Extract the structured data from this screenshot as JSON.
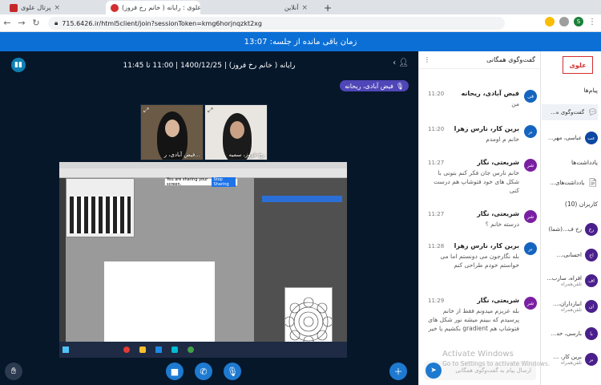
{
  "browser": {
    "tabs": [
      {
        "title": "پرتال علوی"
      },
      {
        "title": "علوی : رایانه ( خانم رخ فروز)"
      },
      {
        "title": "آنلاین"
      }
    ],
    "new_tab": "+",
    "url": "715.6426.ir/html5client/join?sessionToken=kmg6horjnqzkt2xg",
    "profile_initial": "S"
  },
  "banner": {
    "text": "زمان باقی مانده از جلسه: 13:07"
  },
  "meeting": {
    "title": "رایانه ( خانم رخ فروز) | 1400/12/25 | 11:00 تا 11:45",
    "talking_badge": "فیض آبادی، ریحانه",
    "videos": [
      {
        "label": "فیض آبادی، ر..."
      },
      {
        "label": "رخ فروز، سمیه"
      }
    ],
    "screen_share": {
      "app": "Photoshop",
      "notice": "You are sharing your screen.",
      "stop_label": "Stop Sharing"
    }
  },
  "chat": {
    "title": "گفت‌وگوی همگانی",
    "messages": [
      {
        "initials": "فی",
        "name": "فیض آبادی، ریحانه",
        "time": "11:20",
        "text": "من",
        "color": "#1565c0"
      },
      {
        "initials": "بر",
        "name": "برین کار، نارس زهرا",
        "time": "11:20",
        "text": "خانم م اومدم",
        "color": "#1565c0"
      },
      {
        "initials": "شر",
        "name": "شریعتی، نگار",
        "time": "11:27",
        "text": "خانم نارس جان فکر کنم بتونی با شکل های خود فتوشاپ هم درست کنی",
        "color": "#7b1fa2"
      },
      {
        "initials": "شر",
        "name": "شریعتی، نگار",
        "time": "11:27",
        "text": "درسته خانم ؟",
        "color": "#7b1fa2"
      },
      {
        "initials": "بر",
        "name": "برین کار، نارس زهرا",
        "time": "11:28",
        "text": "بله نگارجون می دونستم اما می خواستم خودم طراحی کنم",
        "color": "#1565c0"
      },
      {
        "initials": "شر",
        "name": "شریعتی، نگار",
        "time": "11:29",
        "text": "بله عزیزم میدونم فقط از خانم پرسیدم که ببینم میشه نور شکل های فتوشاپ هم gradient بکشیم یا خیر",
        "color": "#7b1fa2"
      }
    ],
    "input_placeholder": "ارسال پیام به گفت‌وگوی همگانی",
    "watermark_line1": "Activate Windows",
    "watermark_line2": "Go to Settings to activate Windows."
  },
  "sidebar": {
    "logo": "علوی",
    "messages_title": "پیام‌ها",
    "public_chat": "گفت‌وگوی ه...",
    "private_chat_name": "عباسی، مهر...",
    "private_chat_initials": "عب",
    "notes_title": "یادداشت‌ها",
    "shared_notes": "یادداشت‌های...",
    "users_title": "کاربران (10)",
    "users": [
      {
        "initials": "رخ",
        "name": "رخ ف...(شما)",
        "sub": ""
      },
      {
        "initials": "اح",
        "name": "احسانی،...",
        "sub": ""
      },
      {
        "initials": "اف",
        "name": "افراه، سارب...",
        "sub": "تلفن‌همراه"
      },
      {
        "initials": "ان",
        "name": "انبازداران،...",
        "sub": "تلفن‌همراه"
      },
      {
        "initials": "با",
        "name": "بارسی، حد...",
        "sub": ""
      },
      {
        "initials": "بر",
        "name": "برین کار، ...",
        "sub": "تلفن‌همراه"
      }
    ]
  }
}
